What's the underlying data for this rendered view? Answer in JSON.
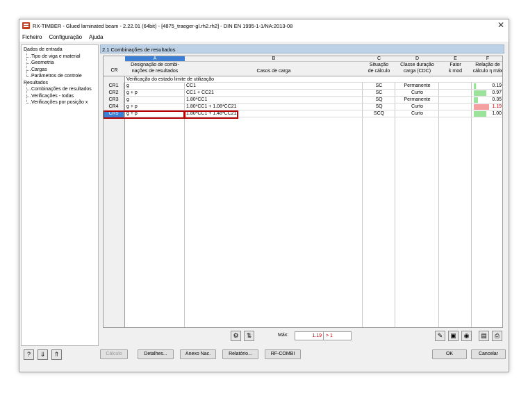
{
  "window": {
    "title": "RX-TIMBER - Glued laminated beam - 2.22.01 (64bit) - [4875_traeger-gl.rh2.rh2] - DIN EN 1995-1-1/NA:2013-08",
    "close": "✕"
  },
  "menu": [
    "Ficheiro",
    "Configuração",
    "Ajuda"
  ],
  "tree": {
    "root1": "Dados de entrada",
    "input_children": [
      "Tipo de viga e material",
      "Geometria",
      "Cargas",
      "Parâmetros de controle"
    ],
    "root2": "Resultados",
    "result_children": [
      "Combinações de resultados",
      "Verificações - todas",
      "Verificações por posição x"
    ]
  },
  "panel": {
    "title": "2.1 Combinações de resultados"
  },
  "table": {
    "letters": [
      "A",
      "B",
      "C",
      "D",
      "E",
      "F"
    ],
    "header_cr": "CR",
    "headers": [
      [
        "Designação de combi-",
        "nações de resultados"
      ],
      [
        "",
        "Casos de carga"
      ],
      [
        "Situação",
        "de cálculo"
      ],
      [
        "Classe duração",
        "carga (CDC)"
      ],
      [
        "Fator",
        "k mod"
      ],
      [
        "Relação de",
        "cálculo η máx"
      ]
    ],
    "subheader": "Verificação do estado limite de utilização",
    "rows": [
      {
        "cr": "CR1",
        "a": "g",
        "b": "CC1",
        "c": "SC",
        "d": "Permanente",
        "e": "",
        "f": "0.19",
        "ratio": 0.19
      },
      {
        "cr": "CR2",
        "a": "g + p",
        "b": "CC1 + CC21",
        "c": "SC",
        "d": "Curto",
        "e": "",
        "f": "0.97",
        "ratio": 0.97
      },
      {
        "cr": "CR3",
        "a": "g",
        "b": "1.80*CC1",
        "c": "SQ",
        "d": "Permanente",
        "e": "",
        "f": "0.35",
        "ratio": 0.35
      },
      {
        "cr": "CR4",
        "a": "g + p",
        "b": "1.80*CC1 + 1.08*CC21",
        "c": "SQ",
        "d": "Curto",
        "e": "",
        "f": "1.19",
        "ratio": 1.19
      },
      {
        "cr": "CR5",
        "a": "g + p",
        "b": "1.80*CC1 + 1.48*CC21",
        "c": "SCQ",
        "d": "Curto",
        "e": "",
        "f": "1.00",
        "ratio": 1.0
      }
    ],
    "ok_color": "#9be39b",
    "fail_color": "#f4a0a0",
    "selected_color": "#3c7fd4",
    "highlight_color": "#b40000"
  },
  "toolbar": {
    "max_label": "Máx:",
    "max_value": "1.19",
    "max_flag": "> 1"
  },
  "buttons": {
    "calc": "Cálculo",
    "details": "Detalhes...",
    "annex": "Anexo Nac.",
    "report": "Relatório...",
    "rfcombi": "RF-COMBI",
    "ok": "OK",
    "cancel": "Cancelar"
  }
}
